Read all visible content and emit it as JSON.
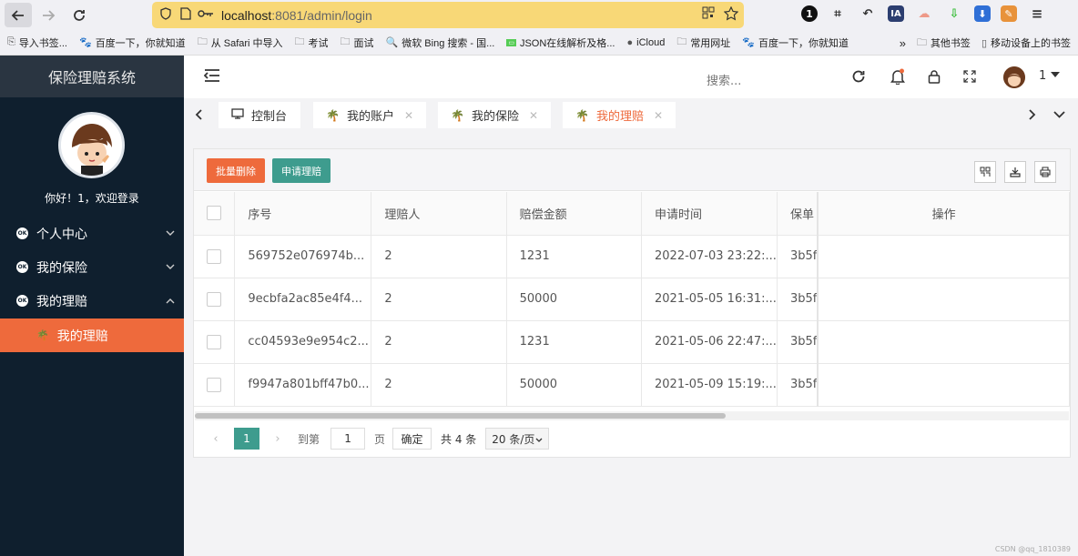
{
  "browser": {
    "url_host": "localhost",
    "url_rest": ":8081/admin/login",
    "bookmarks": [
      {
        "label": "导入书签...",
        "icon": "import-icon"
      },
      {
        "label": "百度一下，你就知道",
        "icon": "baidu-icon"
      },
      {
        "label": "从 Safari 中导入",
        "icon": "folder-icon"
      },
      {
        "label": "考试",
        "icon": "folder-icon"
      },
      {
        "label": "面试",
        "icon": "folder-icon"
      },
      {
        "label": "微软 Bing 搜索 - 国...",
        "icon": "search-icon"
      },
      {
        "label": "JSON在线解析及格...",
        "icon": "json-icon"
      },
      {
        "label": "iCloud",
        "icon": "apple-icon"
      },
      {
        "label": "常用网址",
        "icon": "folder-icon"
      },
      {
        "label": "百度一下，你就知道",
        "icon": "baidu-icon"
      }
    ],
    "bookmarks_other": "其他书签",
    "bookmarks_mobile": "移动设备上的书签"
  },
  "sidebar": {
    "system_title": "保险理赔系统",
    "welcome": "你好！1，欢迎登录",
    "menu": [
      {
        "label": "个人中心",
        "expanded": false
      },
      {
        "label": "我的保险",
        "expanded": false
      },
      {
        "label": "我的理赔",
        "expanded": true
      }
    ],
    "active_sub": "我的理赔"
  },
  "header": {
    "search_placeholder": "搜索...",
    "user_name": "1"
  },
  "tabs": [
    {
      "label": "控制台",
      "closable": false,
      "active": false
    },
    {
      "label": "我的账户",
      "closable": true,
      "active": false
    },
    {
      "label": "我的保险",
      "closable": true,
      "active": false
    },
    {
      "label": "我的理赔",
      "closable": true,
      "active": true
    }
  ],
  "toolbar": {
    "batch_delete": "批量删除",
    "apply_claim": "申请理赔"
  },
  "table": {
    "columns": [
      "序号",
      "理赔人",
      "赔偿金额",
      "申请时间",
      "保单",
      "操作"
    ],
    "rows": [
      {
        "id": "569752e076974b...",
        "claimant": "2",
        "amount": "1231",
        "time": "2022-07-03 23:22:...",
        "policy": "3b5f"
      },
      {
        "id": "9ecbfa2ac85e4f4...",
        "claimant": "2",
        "amount": "50000",
        "time": "2021-05-05 16:31:...",
        "policy": "3b5f"
      },
      {
        "id": "cc04593e9e954c2...",
        "claimant": "2",
        "amount": "1231",
        "time": "2021-05-06 22:47:...",
        "policy": "3b5f"
      },
      {
        "id": "f9947a801bff47b0...",
        "claimant": "2",
        "amount": "50000",
        "time": "2021-05-09 15:19:...",
        "policy": "3b5f"
      }
    ]
  },
  "pager": {
    "current_page": "1",
    "goto_label": "到第",
    "goto_value": "1",
    "page_unit": "页",
    "confirm": "确定",
    "total": "共 4 条",
    "page_size": "20 条/页"
  },
  "colors": {
    "accent_orange": "#ee6a3c",
    "accent_teal": "#3e9c8e",
    "sidebar_bg": "#0f1f2e",
    "url_bar": "#f8d877"
  },
  "watermark": "CSDN @qq_1810389"
}
